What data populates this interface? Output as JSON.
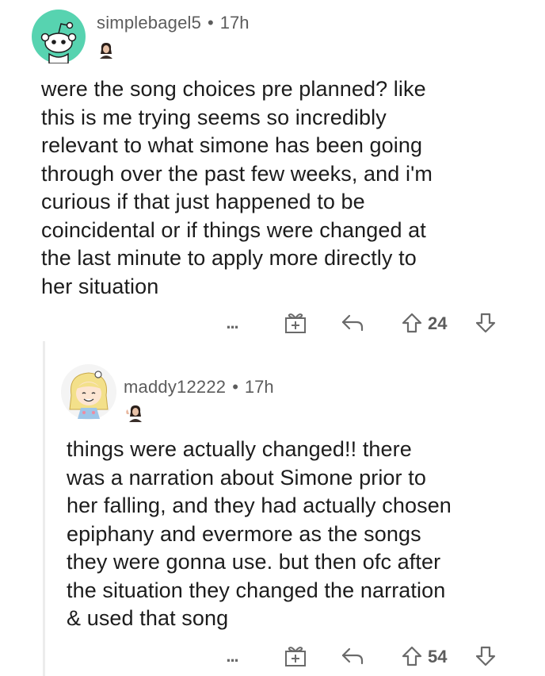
{
  "comment1": {
    "username": "simplebagel5",
    "separator": "•",
    "time": "17h",
    "text_lines": [
      "were the song choices pre planned? like",
      "this is me trying seems so incredibly",
      "relevant to what simone has been going",
      "through over the past few weeks, and i'm",
      "curious if that just happened to be",
      "coincidental or if things were changed at",
      "the last minute to apply more directly to",
      "her situation"
    ],
    "more_label": "...",
    "score": "24",
    "avatar_icon": "reddit-snoo-avatar",
    "avatar_color": "#57d3b0",
    "flair_icon": "taylor-swift-flair-icon"
  },
  "comment2": {
    "username": "maddy12222",
    "separator": "•",
    "time": "17h",
    "text_lines": [
      "things were actually changed!! there",
      "was a narration about Simone prior to",
      "her falling, and they had actually chosen",
      "epiphany and evermore as the songs",
      "they were gonna use. but then ofc after",
      "the situation they changed the narration",
      "& used that song"
    ],
    "more_label": "...",
    "score": "54",
    "avatar_icon": "blonde-girl-avatar",
    "flair_icon": "taylor-swift-flair-icon"
  }
}
